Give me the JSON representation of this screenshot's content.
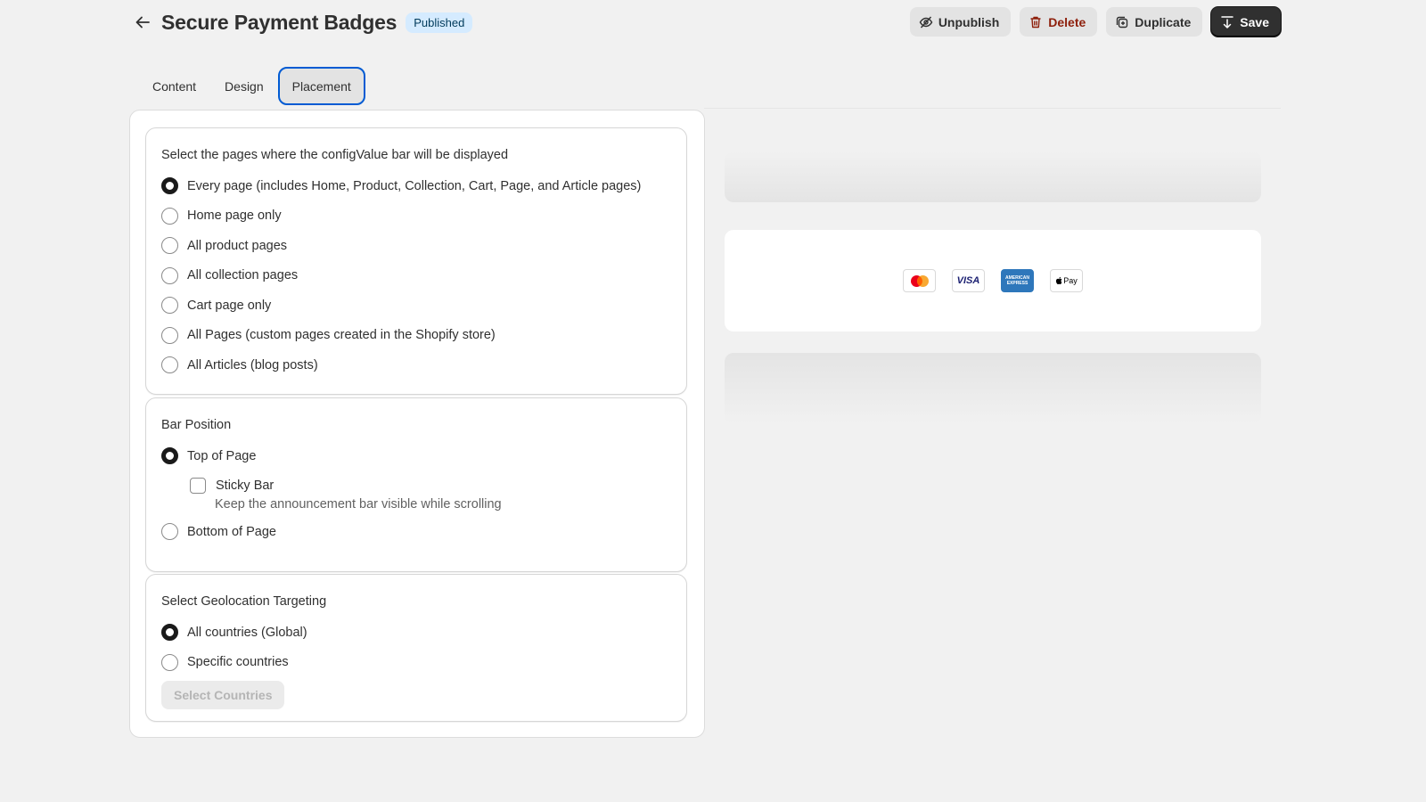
{
  "header": {
    "title": "Secure Payment Badges",
    "status_badge": "Published",
    "actions": {
      "unpublish": "Unpublish",
      "delete": "Delete",
      "duplicate": "Duplicate",
      "save": "Save"
    }
  },
  "tabs": [
    {
      "label": "Content"
    },
    {
      "label": "Design"
    },
    {
      "label": "Placement",
      "active": true
    }
  ],
  "pages_section": {
    "heading": "Select the pages where the configValue bar will be displayed",
    "options": [
      {
        "label": "Every page (includes Home, Product, Collection, Cart, Page, and Article pages)",
        "selected": true
      },
      {
        "label": "Home page only",
        "selected": false
      },
      {
        "label": "All product pages",
        "selected": false
      },
      {
        "label": "All collection pages",
        "selected": false
      },
      {
        "label": "Cart page only",
        "selected": false
      },
      {
        "label": "All Pages (custom pages created in the Shopify store)",
        "selected": false
      },
      {
        "label": "All Articles (blog posts)",
        "selected": false
      }
    ]
  },
  "position_section": {
    "heading": "Bar Position",
    "top_label": "Top of Page",
    "top_selected": true,
    "sticky_label": "Sticky Bar",
    "sticky_checked": false,
    "sticky_help": "Keep the announcement bar visible while scrolling",
    "bottom_label": "Bottom of Page",
    "bottom_selected": false
  },
  "geo_section": {
    "heading": "Select Geolocation Targeting",
    "global_label": "All countries (Global)",
    "global_selected": true,
    "specific_label": "Specific countries",
    "specific_selected": false,
    "select_button": "Select Countries"
  },
  "preview": {
    "badges": [
      {
        "name": "mastercard-icon"
      },
      {
        "name": "visa-icon",
        "text": "VISA"
      },
      {
        "name": "amex-icon",
        "text": "AMERICAN EXPRESS"
      },
      {
        "name": "apple-pay-icon",
        "text": "Pay"
      }
    ]
  },
  "colors": {
    "accent": "#005bd3",
    "badge_bg": "#d5ebff",
    "danger": "#8e1f0b",
    "primary_button": "#303030"
  }
}
